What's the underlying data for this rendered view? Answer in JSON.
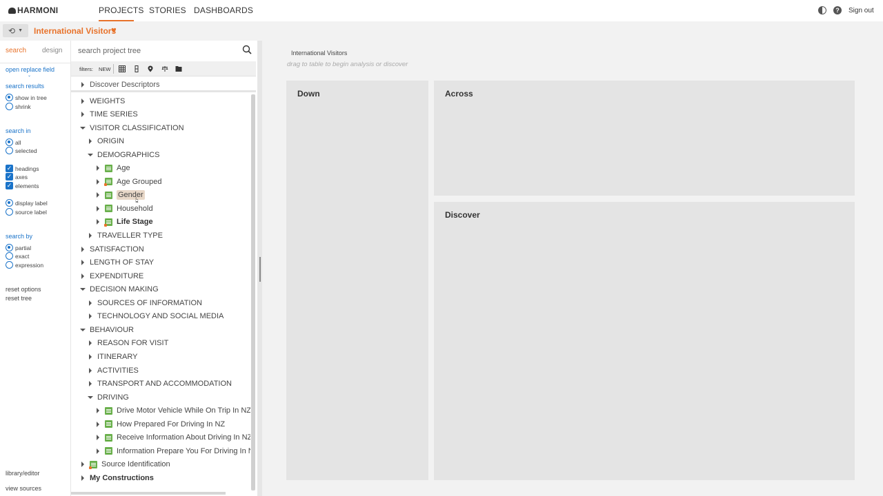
{
  "app": {
    "logo": "HARMONI"
  },
  "nav": {
    "tabs": [
      "PROJECTS",
      "STORIES",
      "DASHBOARDS"
    ],
    "active": "PROJECTS",
    "signout": "Sign out"
  },
  "project": {
    "title": "International Visitors"
  },
  "left_panel": {
    "tabs": {
      "search": "search",
      "design": "design"
    },
    "open_replace_field": "open replace field",
    "search_results": {
      "heading": "search results",
      "options": [
        "show in tree",
        "shrink"
      ],
      "selected": "show in tree"
    },
    "search_in": {
      "heading": "search in",
      "options": [
        "all",
        "selected"
      ],
      "selected": "all"
    },
    "include": [
      "headings",
      "axes",
      "elements"
    ],
    "label_mode": {
      "options": [
        "display label",
        "source label"
      ],
      "selected": "display label"
    },
    "search_by": {
      "heading": "search by",
      "options": [
        "partial",
        "exact",
        "expression"
      ],
      "selected": "partial"
    },
    "reset_options": "reset options",
    "reset_tree": "reset tree",
    "library_editor": "library/editor",
    "view_sources": "view sources"
  },
  "tree": {
    "search_placeholder": "search project tree",
    "filters_label": "filters:",
    "filters_new": "NEW",
    "discover_descriptors": "Discover Descriptors",
    "rows": [
      {
        "label": "WEIGHTS",
        "level": 0,
        "state": "collapsed",
        "type": "folder"
      },
      {
        "label": "TIME SERIES",
        "level": 0,
        "state": "collapsed",
        "type": "folder"
      },
      {
        "label": "VISITOR CLASSIFICATION",
        "level": 0,
        "state": "expanded",
        "type": "folder"
      },
      {
        "label": "ORIGIN",
        "level": 1,
        "state": "collapsed",
        "type": "folder"
      },
      {
        "label": "DEMOGRAPHICS",
        "level": 1,
        "state": "expanded",
        "type": "folder"
      },
      {
        "label": "Age",
        "level": 2,
        "state": "collapsed",
        "type": "variable"
      },
      {
        "label": "Age Grouped",
        "level": 2,
        "state": "collapsed",
        "type": "variable-flag"
      },
      {
        "label": "Gender",
        "level": 2,
        "state": "collapsed",
        "type": "variable",
        "highlight": true
      },
      {
        "label": "Household",
        "level": 2,
        "state": "collapsed",
        "type": "variable"
      },
      {
        "label": "Life Stage",
        "level": 2,
        "state": "collapsed",
        "type": "variable-flag",
        "bold": true
      },
      {
        "label": "TRAVELLER TYPE",
        "level": 1,
        "state": "collapsed",
        "type": "folder"
      },
      {
        "label": "SATISFACTION",
        "level": 0,
        "state": "collapsed",
        "type": "folder"
      },
      {
        "label": "LENGTH OF STAY",
        "level": 0,
        "state": "collapsed",
        "type": "folder"
      },
      {
        "label": "EXPENDITURE",
        "level": 0,
        "state": "collapsed",
        "type": "folder"
      },
      {
        "label": "DECISION MAKING",
        "level": 0,
        "state": "expanded",
        "type": "folder"
      },
      {
        "label": "SOURCES OF INFORMATION",
        "level": 1,
        "state": "collapsed",
        "type": "folder"
      },
      {
        "label": "TECHNOLOGY AND SOCIAL MEDIA",
        "level": 1,
        "state": "collapsed",
        "type": "folder"
      },
      {
        "label": "BEHAVIOUR",
        "level": 0,
        "state": "expanded",
        "type": "folder"
      },
      {
        "label": "REASON FOR VISIT",
        "level": 1,
        "state": "collapsed",
        "type": "folder"
      },
      {
        "label": "ITINERARY",
        "level": 1,
        "state": "collapsed",
        "type": "folder"
      },
      {
        "label": "ACTIVITIES",
        "level": 1,
        "state": "collapsed",
        "type": "folder"
      },
      {
        "label": "TRANSPORT AND ACCOMMODATION",
        "level": 1,
        "state": "collapsed",
        "type": "folder"
      },
      {
        "label": "DRIVING",
        "level": 1,
        "state": "expanded",
        "type": "folder"
      },
      {
        "label": "Drive Motor Vehicle While On Trip In NZ",
        "level": 2,
        "state": "collapsed",
        "type": "variable"
      },
      {
        "label": "How Prepared For Driving In NZ",
        "level": 2,
        "state": "collapsed",
        "type": "variable"
      },
      {
        "label": "Receive Information About Driving In NZ",
        "level": 2,
        "state": "collapsed",
        "type": "variable"
      },
      {
        "label": "Information Prepare You For Driving In NZ",
        "level": 2,
        "state": "collapsed",
        "type": "variable"
      },
      {
        "label": "Source Identification",
        "level": 0,
        "state": "collapsed",
        "type": "variable-flag"
      },
      {
        "label": "My Constructions",
        "level": 0,
        "state": "collapsed",
        "type": "folder",
        "bold": true
      }
    ]
  },
  "workspace": {
    "breadcrumb": "International Visitors",
    "hint": "drag to table to begin analysis or discover",
    "panels": {
      "down": "Down",
      "across": "Across",
      "discover": "Discover"
    }
  },
  "colors": {
    "accent": "#e8722a",
    "link": "#1a73c9",
    "variable_icon": "#6ab04c"
  }
}
